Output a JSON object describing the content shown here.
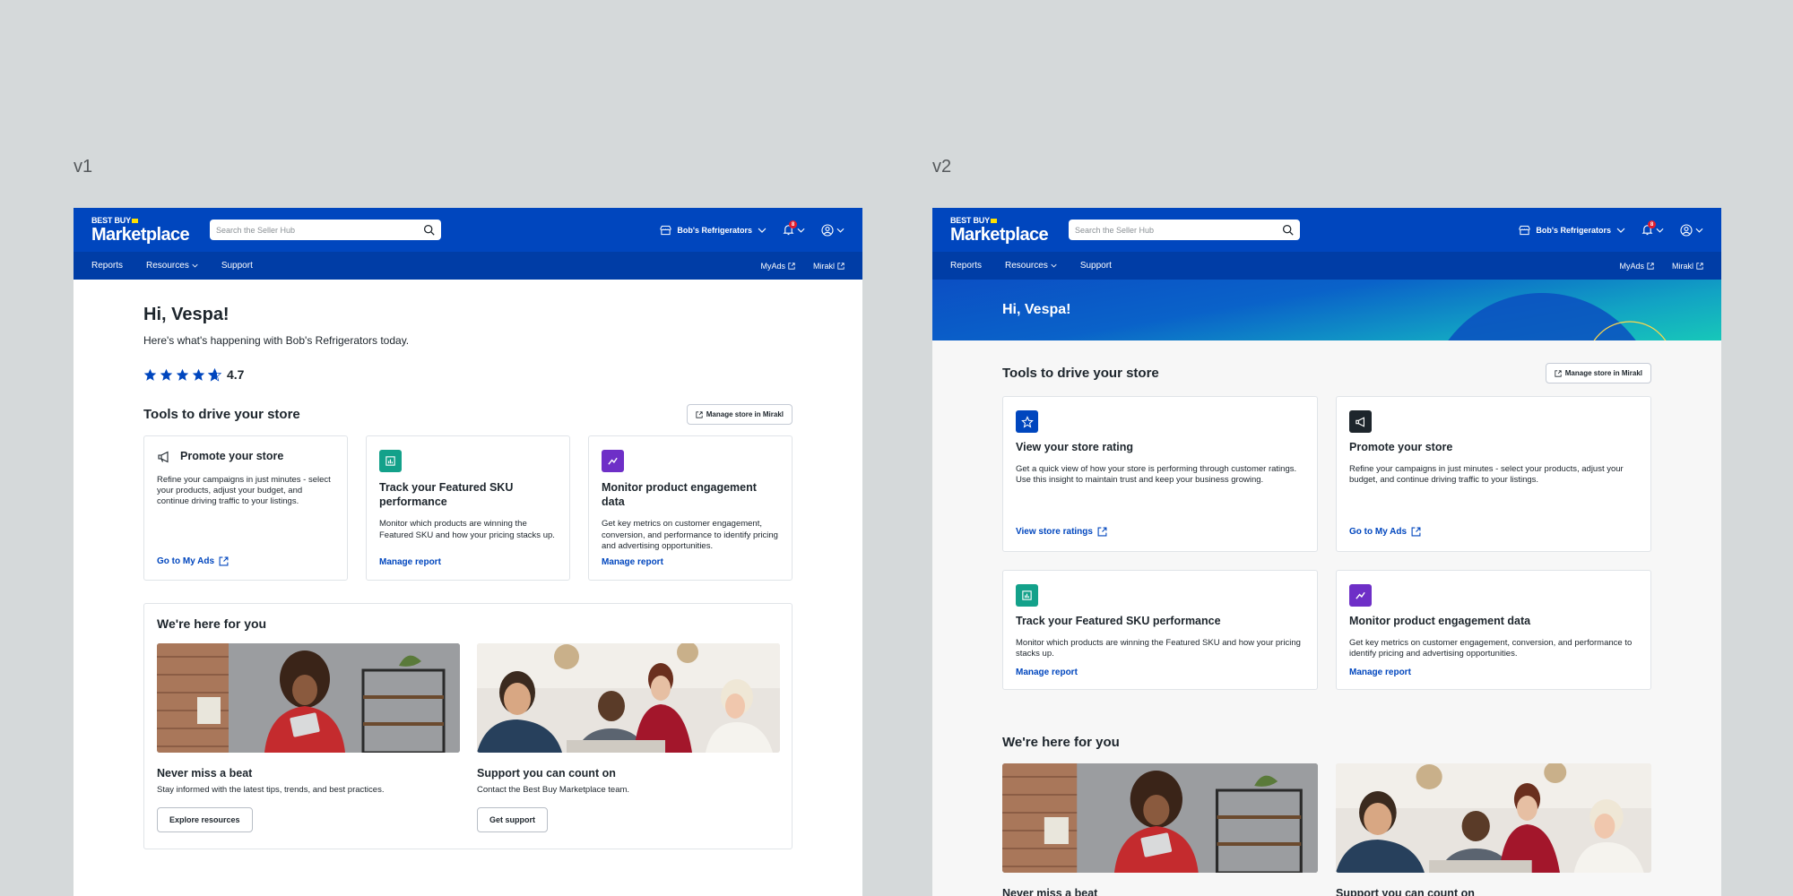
{
  "versions": [
    "v1",
    "v2"
  ],
  "header": {
    "logo_top": "BEST BUY",
    "logo_main": "Marketplace",
    "search_placeholder": "Search the Seller Hub",
    "store_name": "Bob's Refrigerators",
    "notification_count": "8"
  },
  "nav": {
    "items": [
      "Reports",
      "Resources",
      "Support"
    ],
    "right_links": [
      "MyAds",
      "Mirakl"
    ]
  },
  "greeting": "Hi, Vespa!",
  "subtitle": "Here's what's happening with Bob's Refrigerators today.",
  "rating_value": "4.7",
  "tools": {
    "title": "Tools to drive your store",
    "manage_button": "Manage store in Mirakl"
  },
  "cards": {
    "rating": {
      "title": "View your store rating",
      "desc": "Get a quick view of how your store is performing through customer ratings. Use this insight to maintain trust and keep your business growing.",
      "link": "View store ratings"
    },
    "promote": {
      "title": "Promote your store",
      "desc_v1": "Refine your campaigns in just minutes - select your products, adjust your budget, and continue driving traffic to your listings.",
      "desc_v2": "Refine your campaigns in just minutes - select your products, adjust your budget, and continue driving traffic to your listings.",
      "link": "Go to My Ads"
    },
    "sku": {
      "title": "Track your Featured SKU performance",
      "desc": "Monitor which products are winning the Featured SKU and how your pricing stacks up.",
      "link": "Manage report"
    },
    "monitor": {
      "title": "Monitor product engagement data",
      "desc": "Get key metrics on customer engagement, conversion, and performance to identify pricing and advertising opportunities.",
      "link": "Manage report"
    }
  },
  "here": {
    "title": "We're here for you",
    "items": [
      {
        "title": "Never miss a beat",
        "desc": "Stay informed with the latest tips, trends, and best practices.",
        "button": "Explore resources"
      },
      {
        "title": "Support you can count on",
        "desc": "Contact the Best Buy Marketplace team.",
        "button": "Get support"
      }
    ]
  },
  "colors": {
    "brand_blue": "#0046be",
    "nav_blue": "#003da6",
    "link": "#0046be",
    "teal": "#13a18a",
    "purple": "#6e2fc7",
    "star": "#0046be",
    "banner_teal": "#14c3b8"
  }
}
